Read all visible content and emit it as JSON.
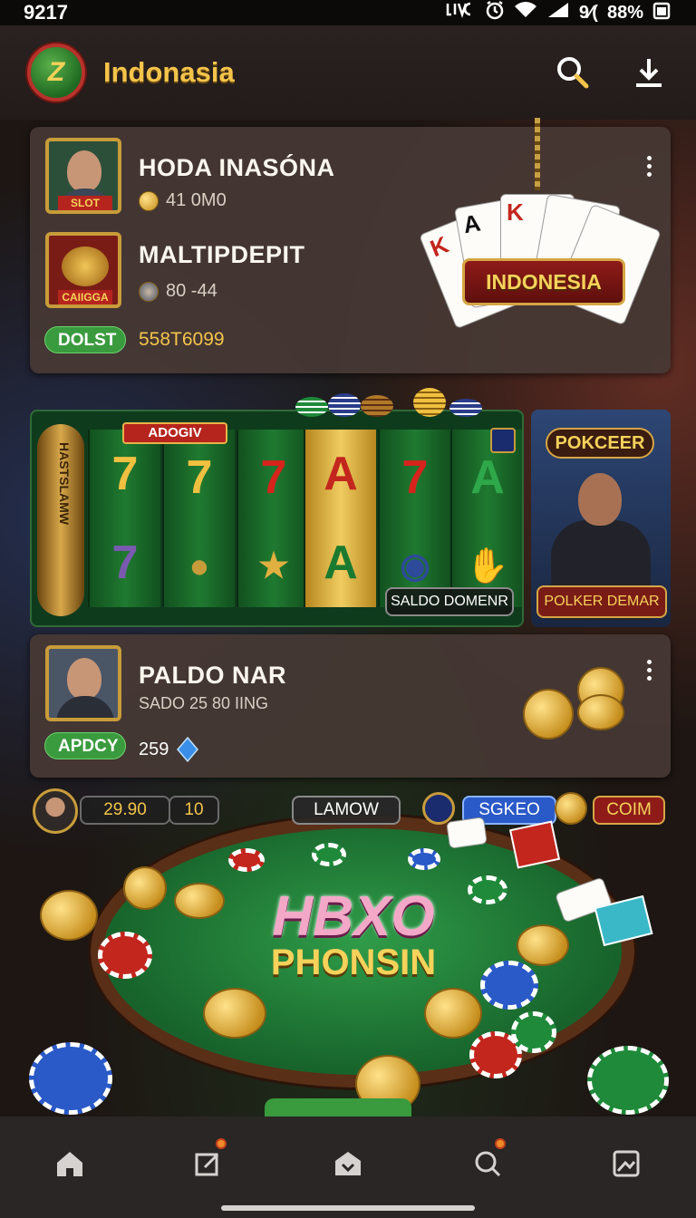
{
  "status_bar": {
    "time": "9217",
    "icons": [
      "nfc-icon",
      "alarm-icon",
      "wifi-icon",
      "signal-icon"
    ],
    "signal_text": "9⁄(",
    "battery_percent": "88%"
  },
  "app_bar": {
    "logo_glyph": "Z",
    "title": "Indonasia",
    "actions": [
      "search-icon",
      "download-icon"
    ]
  },
  "top_card": {
    "player1": {
      "name": "HODA INASÓNA",
      "avatar_tag": "SLOT",
      "coins": "41 0M0"
    },
    "player2": {
      "name": "MALTIPDEPIT",
      "avatar_tag": "CAIIGGA",
      "stat": "80 -44"
    },
    "pill_label": "DOLST",
    "balance": "558T6099",
    "banner_text": "INDONESIA",
    "card_letters": [
      "K",
      "A",
      "K"
    ]
  },
  "slot_game": {
    "label": "ADOGIV",
    "rail_text": "HASTSLAMW",
    "reels_top": [
      "7",
      "7",
      "7",
      "A",
      "7",
      "A"
    ],
    "reels_bottom": [
      "7",
      "●",
      "★",
      "A",
      "◉",
      "✋"
    ],
    "balance_label": "SALDO DOMENR"
  },
  "poker_promo": {
    "title": "POKCEER",
    "button_label": "POLKER DEMAR"
  },
  "player_card": {
    "name": "PALDO NAR",
    "subtitle": "SADO 25 80 IING",
    "pill_label": "APDCY",
    "gems": "259"
  },
  "game_hud": {
    "balance": "29.90",
    "level": "10",
    "center_label": "LAMOW",
    "score_label": "SGKEO",
    "coin_label": "COIM"
  },
  "table_title": {
    "line1": "HBXO",
    "line2": "PHONSIN"
  },
  "bottom_nav": {
    "items": [
      "home-icon",
      "edit-icon",
      "shop-icon",
      "search-icon",
      "gallery-icon"
    ]
  },
  "colors": {
    "accent_gold": "#f4c44a",
    "pill_green": "#3a9a3e",
    "card_bg": "#463834",
    "felt_green": "#2f9c48"
  }
}
